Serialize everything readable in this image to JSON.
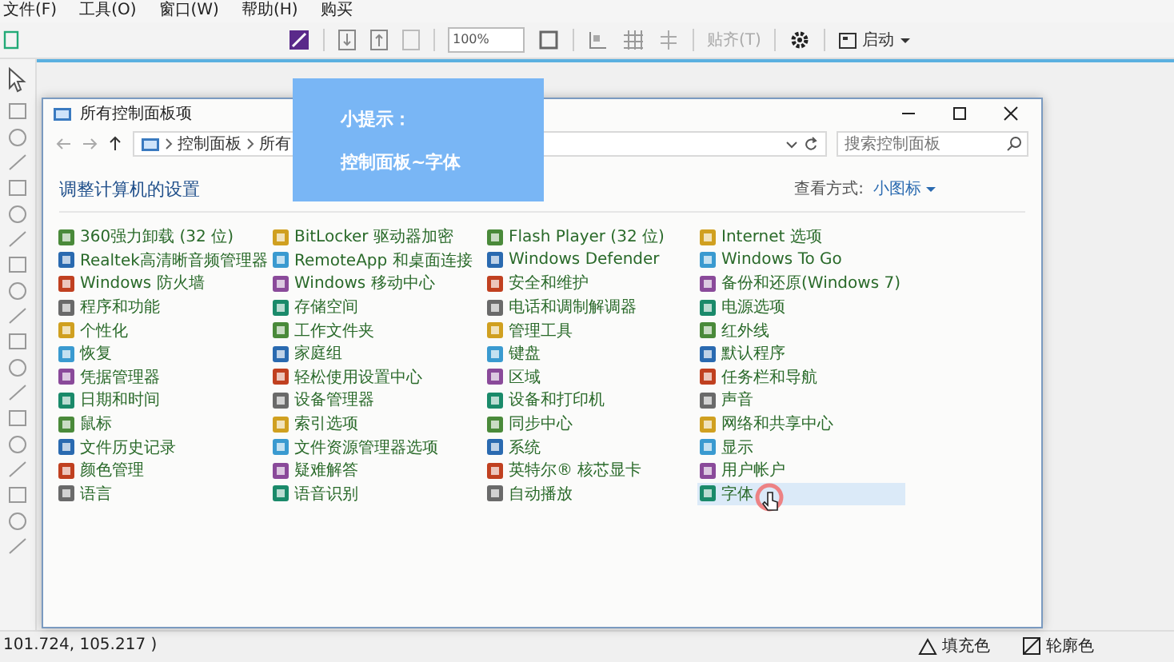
{
  "menu": [
    "文件(F)",
    "工具(O)",
    "窗口(W)",
    "帮助(H)",
    "购买"
  ],
  "toolbar": {
    "zoom": "100%",
    "snap": "贴齐(T)",
    "launch": "启动"
  },
  "window": {
    "title": "所有控制面板项",
    "breadcrumb": [
      "控制面板",
      "所有"
    ],
    "search": {
      "placeholder": "搜索控制面板"
    },
    "heading": "调整计算机的设置",
    "view_label": "查看方式:",
    "view_value": "小图标",
    "columns": [
      {
        "items": [
          {
            "label": "360强力卸载 (32 位)",
            "selected": false
          },
          {
            "label": "Realtek高清晰音频管理器",
            "selected": false
          },
          {
            "label": "Windows 防火墙",
            "selected": false
          },
          {
            "label": "程序和功能",
            "selected": false
          },
          {
            "label": "个性化",
            "selected": false
          },
          {
            "label": "恢复",
            "selected": false
          },
          {
            "label": "凭据管理器",
            "selected": false
          },
          {
            "label": "日期和时间",
            "selected": false
          },
          {
            "label": "鼠标",
            "selected": false
          },
          {
            "label": "文件历史记录",
            "selected": false
          },
          {
            "label": "颜色管理",
            "selected": false
          },
          {
            "label": "语言",
            "selected": false
          }
        ]
      },
      {
        "items": [
          {
            "label": "BitLocker 驱动器加密",
            "selected": false
          },
          {
            "label": "RemoteApp 和桌面连接",
            "selected": false
          },
          {
            "label": "Windows 移动中心",
            "selected": false
          },
          {
            "label": "存储空间",
            "selected": false
          },
          {
            "label": "工作文件夹",
            "selected": false
          },
          {
            "label": "家庭组",
            "selected": false
          },
          {
            "label": "轻松使用设置中心",
            "selected": false
          },
          {
            "label": "设备管理器",
            "selected": false
          },
          {
            "label": "索引选项",
            "selected": false
          },
          {
            "label": "文件资源管理器选项",
            "selected": false
          },
          {
            "label": "疑难解答",
            "selected": false
          },
          {
            "label": "语音识别",
            "selected": false
          }
        ]
      },
      {
        "items": [
          {
            "label": "Flash Player (32 位)",
            "selected": false
          },
          {
            "label": "Windows Defender",
            "selected": false
          },
          {
            "label": "安全和维护",
            "selected": false
          },
          {
            "label": "电话和调制解调器",
            "selected": false
          },
          {
            "label": "管理工具",
            "selected": false
          },
          {
            "label": "键盘",
            "selected": false
          },
          {
            "label": "区域",
            "selected": false
          },
          {
            "label": "设备和打印机",
            "selected": false
          },
          {
            "label": "同步中心",
            "selected": false
          },
          {
            "label": "系统",
            "selected": false
          },
          {
            "label": "英特尔® 核芯显卡",
            "selected": false
          },
          {
            "label": "自动播放",
            "selected": false
          }
        ]
      },
      {
        "items": [
          {
            "label": "Internet 选项",
            "selected": false
          },
          {
            "label": "Windows To Go",
            "selected": false
          },
          {
            "label": "备份和还原(Windows 7)",
            "selected": false
          },
          {
            "label": "电源选项",
            "selected": false
          },
          {
            "label": "红外线",
            "selected": false
          },
          {
            "label": "默认程序",
            "selected": false
          },
          {
            "label": "任务栏和导航",
            "selected": false
          },
          {
            "label": "声音",
            "selected": false
          },
          {
            "label": "网络和共享中心",
            "selected": false
          },
          {
            "label": "显示",
            "selected": false
          },
          {
            "label": "用户帐户",
            "selected": false
          },
          {
            "label": "字体",
            "selected": true
          }
        ]
      }
    ]
  },
  "tip": {
    "title": "小提示：",
    "text": "控制面板~字体"
  },
  "status_bar": {
    "coordinates": "101.724, 105.217 )",
    "fill": "填充色",
    "outline": "轮廓色"
  }
}
